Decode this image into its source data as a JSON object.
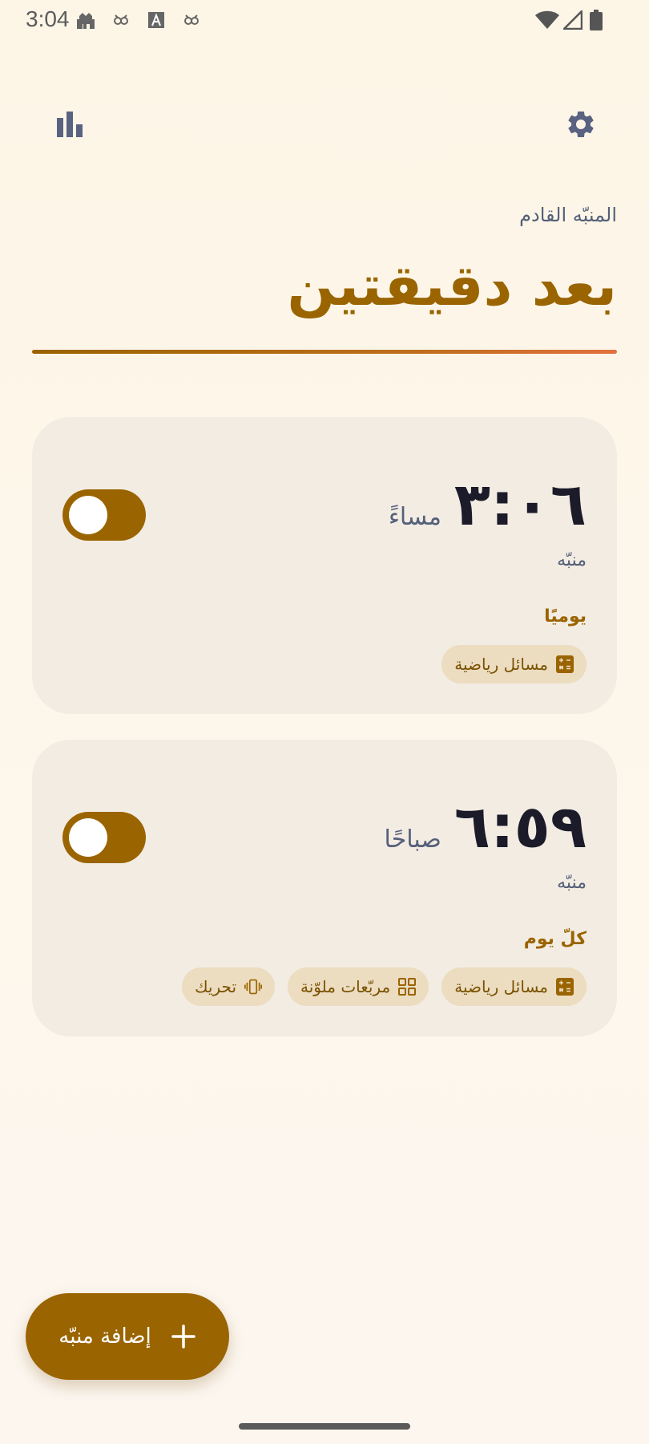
{
  "status_bar": {
    "time": "3:04",
    "icons": [
      "mosque-icon",
      "owl-icon",
      "translate-icon",
      "owl-icon",
      "wifi-icon",
      "signal-icon",
      "battery-icon"
    ]
  },
  "toolbar": {
    "stats_icon": "bar-chart-icon",
    "settings_icon": "gear-icon"
  },
  "next_alarm": {
    "label": "المنبّه القادم",
    "countdown": "بعد دقيقتين"
  },
  "alarms": [
    {
      "time": "٣:٠٦",
      "period": "مساءً",
      "label": "منبّه",
      "repeat": "يوميًا",
      "enabled": false,
      "challenges": [
        {
          "label": "مسائل رياضية",
          "icon": "calculator-icon"
        }
      ]
    },
    {
      "time": "٦:٥٩",
      "period": "صباحًا",
      "label": "منبّه",
      "repeat": "كلّ يوم",
      "enabled": false,
      "challenges": [
        {
          "label": "مسائل رياضية",
          "icon": "calculator-icon"
        },
        {
          "label": "مربّعات ملوّنة",
          "icon": "grid-icon"
        },
        {
          "label": "تحريك",
          "icon": "vibrate-icon"
        }
      ]
    }
  ],
  "fab": {
    "label": "إضافة منبّه",
    "icon": "plus-icon"
  },
  "colors": {
    "accent": "#9a6400",
    "background": "#fdf5e6",
    "card": "#f3ece3",
    "chip": "#ecdcc0"
  }
}
